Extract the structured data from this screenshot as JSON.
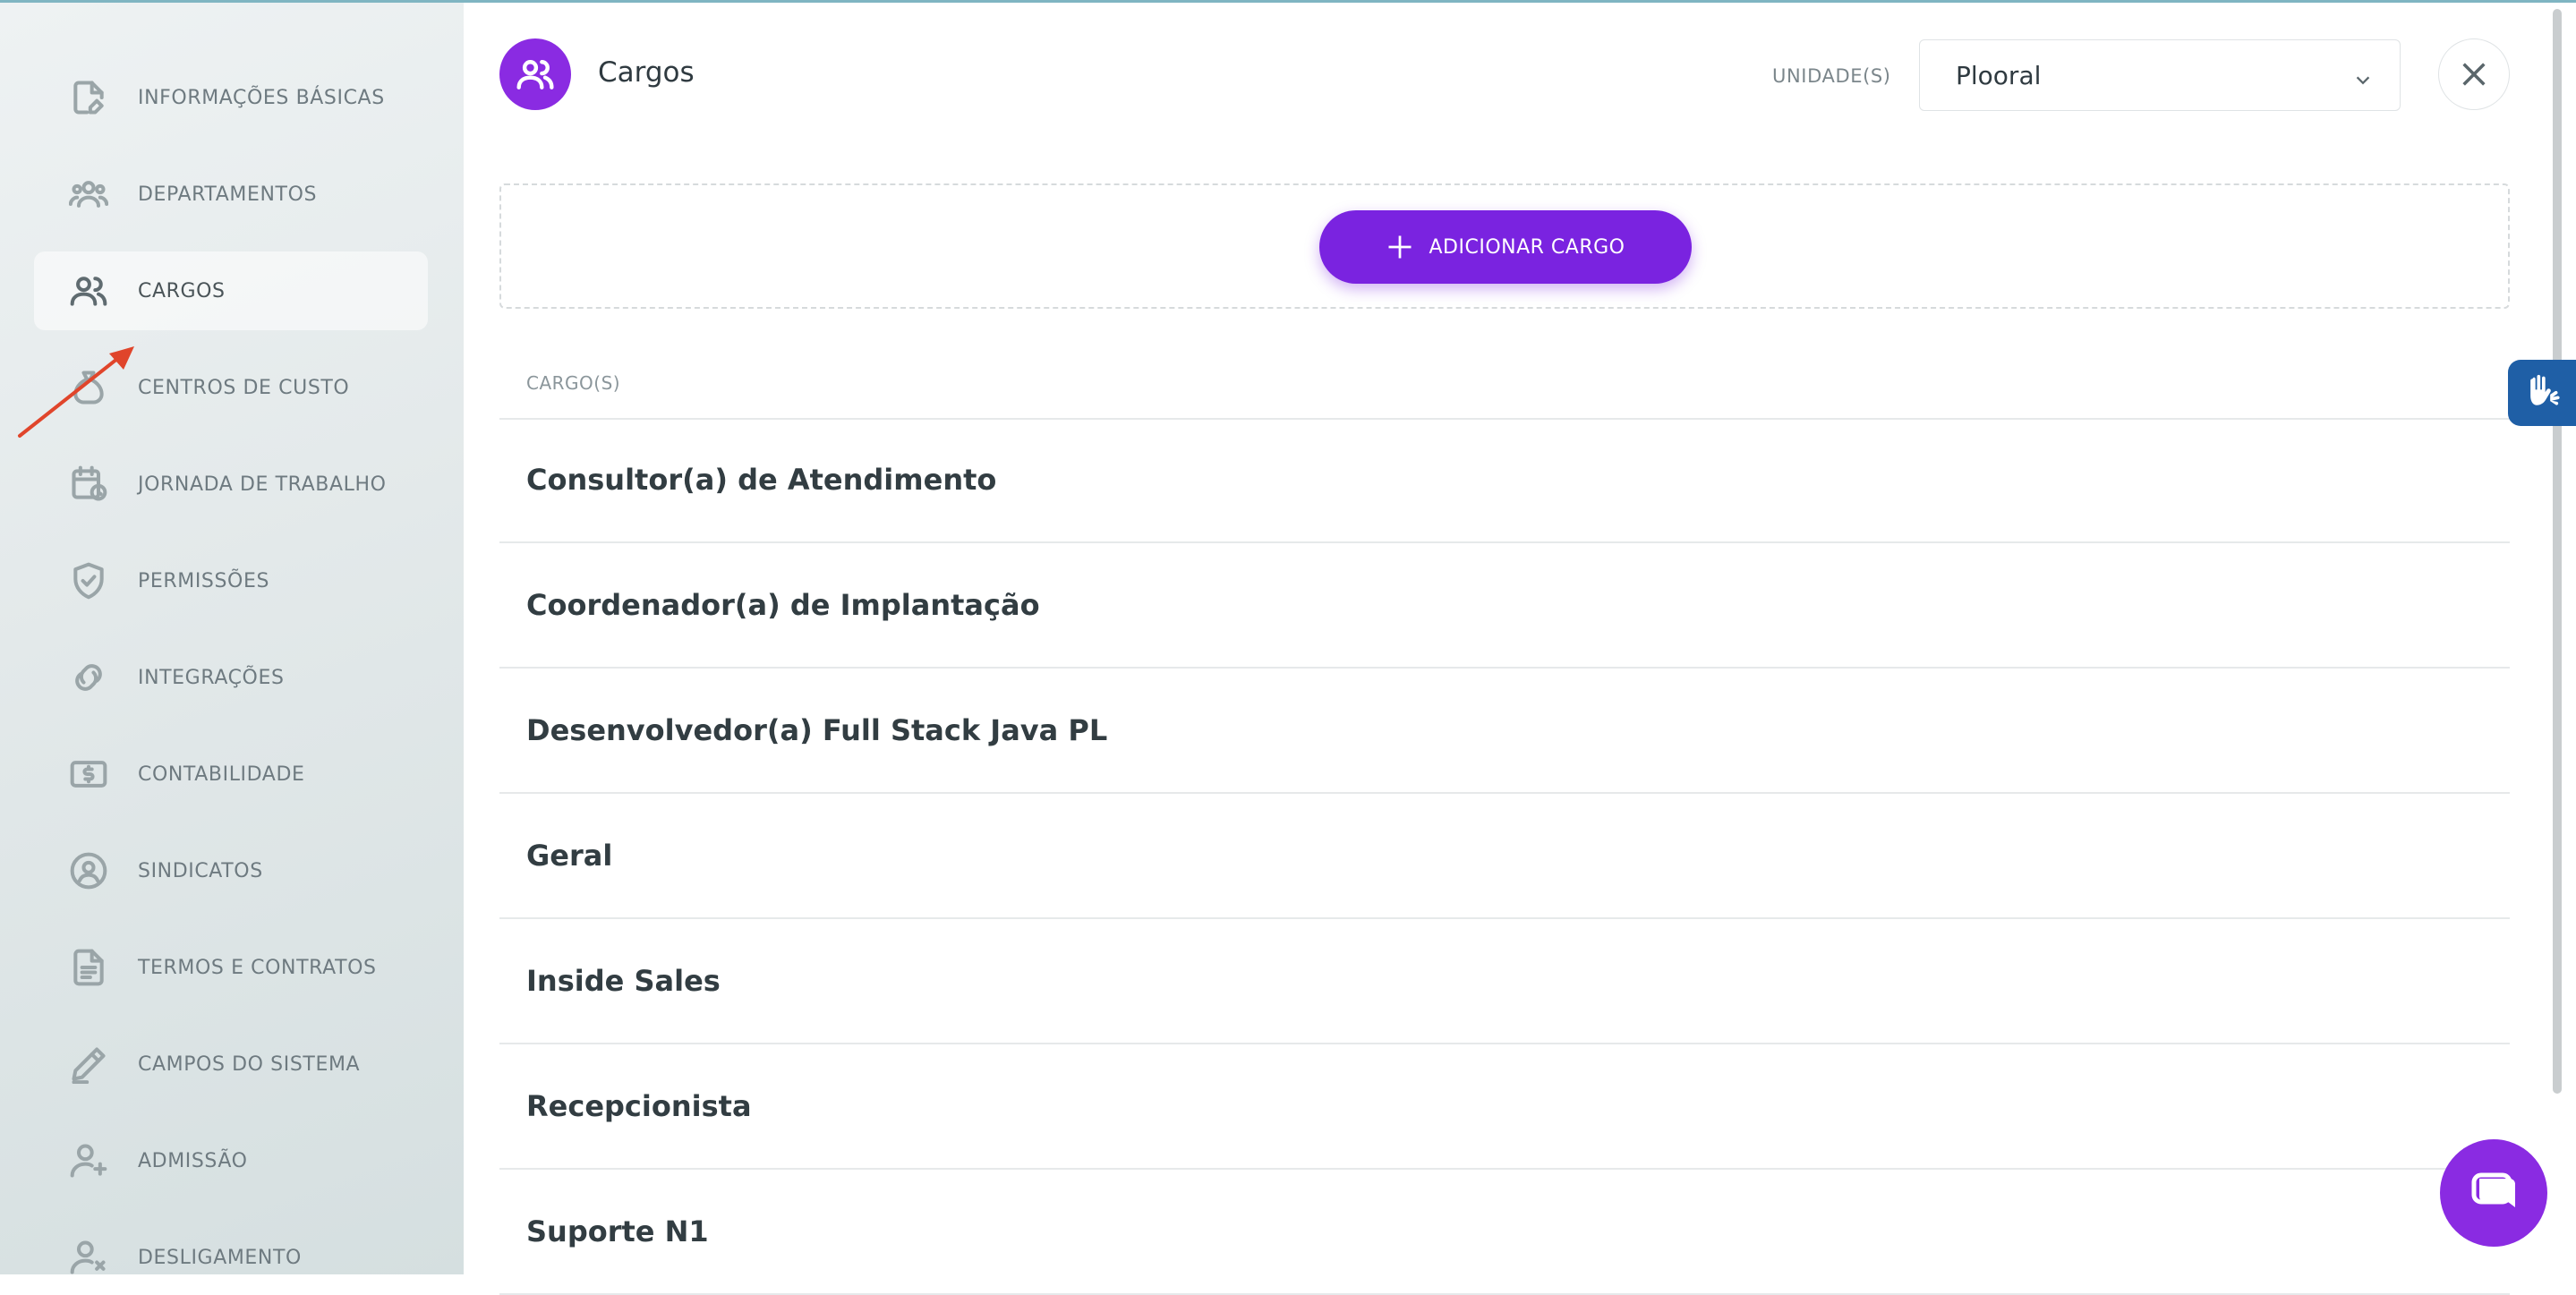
{
  "sidebar": {
    "items": [
      {
        "label": "INFORMAÇÕES BÁSICAS",
        "icon": "document-edit-icon"
      },
      {
        "label": "DEPARTAMENTOS",
        "icon": "people-group-icon"
      },
      {
        "label": "CARGOS",
        "icon": "people-icon",
        "active": true
      },
      {
        "label": "CENTROS DE CUSTO",
        "icon": "money-bag-icon"
      },
      {
        "label": "JORNADA DE TRABALHO",
        "icon": "calendar-clock-icon"
      },
      {
        "label": "PERMISSÕES",
        "icon": "shield-check-icon"
      },
      {
        "label": "INTEGRAÇÕES",
        "icon": "link-icon"
      },
      {
        "label": "CONTABILIDADE",
        "icon": "dollar-bill-icon"
      },
      {
        "label": "SINDICATOS",
        "icon": "user-circle-icon"
      },
      {
        "label": "TERMOS E CONTRATOS",
        "icon": "contract-icon"
      },
      {
        "label": "CAMPOS DO SISTEMA",
        "icon": "pen-icon"
      },
      {
        "label": "ADMISSÃO",
        "icon": "user-add-icon"
      },
      {
        "label": "DESLIGAMENTO",
        "icon": "user-remove-icon"
      }
    ]
  },
  "header": {
    "title": "Cargos",
    "unit_label": "UNIDADE(S)",
    "unit_value": "Plooral"
  },
  "add_button_label": "ADICIONAR CARGO",
  "list": {
    "column_header": "CARGO(S)",
    "rows": [
      "Consultor(a) de Atendimento",
      "Coordenador(a) de Implantação",
      "Desenvolvedor(a) Full Stack Java PL",
      "Geral",
      "Inside Sales",
      "Recepcionista",
      "Suporte N1"
    ]
  },
  "colors": {
    "accent": "#8a2be2",
    "button": "#7a23e0",
    "a11y_widget": "#1f5fa6",
    "annotation_arrow": "#e0452b"
  }
}
